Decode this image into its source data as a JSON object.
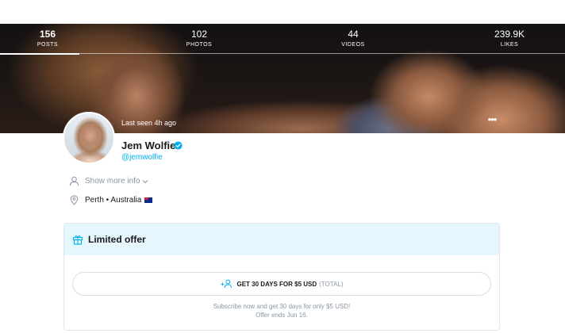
{
  "stats": [
    {
      "value": "156",
      "label": "POSTS"
    },
    {
      "value": "102",
      "label": "PHOTOS"
    },
    {
      "value": "44",
      "label": "VIDEOS"
    },
    {
      "value": "239.9K",
      "label": "LIKES"
    }
  ],
  "profile": {
    "last_seen": "Last seen 4h ago",
    "name": "Jem Wolfie",
    "handle": "@jemwolfie",
    "show_more": "Show more info",
    "location": "Perth • Australia"
  },
  "offer": {
    "title": "Limited offer",
    "button_label": "GET 30 DAYS FOR $5 USD",
    "button_total": "(TOTAL)",
    "note_line1": "Subscribe now and get 30 days for only $5 USD!",
    "note_line2": "Offer ends Jun 16."
  },
  "colors": {
    "accent": "#00aff0",
    "offer_header_bg": "#e6f6fd",
    "muted_text": "#8a96a3"
  },
  "icons": [
    "user-icon",
    "location-pin-icon",
    "chevron-down-icon",
    "gift-icon",
    "add-user-icon",
    "verified-badge-icon",
    "more-options-icon",
    "australia-flag-icon"
  ]
}
